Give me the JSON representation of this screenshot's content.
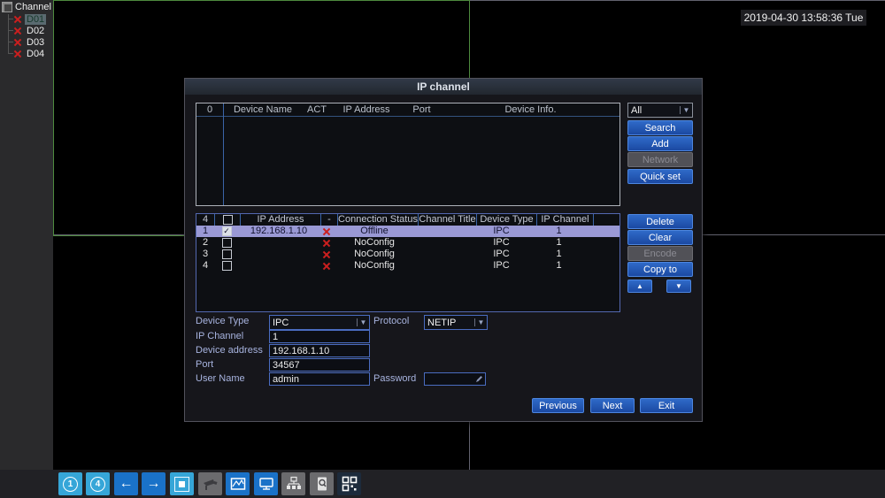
{
  "channel_panel": {
    "title": "Channel",
    "items": [
      {
        "label": "D01",
        "selected": true
      },
      {
        "label": "D02",
        "selected": false
      },
      {
        "label": "D03",
        "selected": false
      },
      {
        "label": "D04",
        "selected": false
      }
    ]
  },
  "clock": "2019-04-30 13:58:36 Tue",
  "dialog": {
    "title": "IP channel",
    "search_table": {
      "count": "0",
      "headers": [
        "Device Name",
        "ACT",
        "IP Address",
        "Port",
        "Device Info."
      ]
    },
    "filter": {
      "value": "All"
    },
    "actions": {
      "search": "Search",
      "add": "Add",
      "network": "Network",
      "quick_set": "Quick set"
    },
    "device_table": {
      "count": "4",
      "headers": [
        "IP Address",
        "-",
        "Connection Status",
        "Channel Title",
        "Device Type",
        "IP Channel"
      ],
      "rows": [
        {
          "index": "1",
          "checked": true,
          "ip": "192.168.1.10",
          "status": "Offline",
          "channel_title": "",
          "device_type": "IPC",
          "ip_channel": "1"
        },
        {
          "index": "2",
          "checked": false,
          "ip": "",
          "status": "NoConfig",
          "channel_title": "",
          "device_type": "IPC",
          "ip_channel": "1"
        },
        {
          "index": "3",
          "checked": false,
          "ip": "",
          "status": "NoConfig",
          "channel_title": "",
          "device_type": "IPC",
          "ip_channel": "1"
        },
        {
          "index": "4",
          "checked": false,
          "ip": "",
          "status": "NoConfig",
          "channel_title": "",
          "device_type": "IPC",
          "ip_channel": "1"
        }
      ]
    },
    "device_actions": {
      "delete": "Delete",
      "clear": "Clear",
      "encode": "Encode",
      "copy_to": "Copy to"
    },
    "form": {
      "device_type": {
        "label": "Device Type",
        "value": "IPC"
      },
      "protocol": {
        "label": "Protocol",
        "value": "NETIP"
      },
      "ip_channel": {
        "label": "IP Channel",
        "value": "1"
      },
      "device_address": {
        "label": "Device address",
        "value": "192.168.1.10"
      },
      "port": {
        "label": "Port",
        "value": "34567"
      },
      "user_name": {
        "label": "User Name",
        "value": "admin"
      },
      "password": {
        "label": "Password",
        "value": ""
      }
    },
    "footer": {
      "previous": "Previous",
      "next": "Next",
      "exit": "Exit"
    }
  },
  "icons": {
    "check": "✓",
    "dropdown": "▼",
    "up": "▲",
    "down": "▼"
  },
  "toolbar": {
    "buttons": [
      {
        "name": "single-view",
        "glyph": "1"
      },
      {
        "name": "quad-view",
        "glyph": "4"
      },
      {
        "name": "previous-channel",
        "glyph": "←"
      },
      {
        "name": "next-channel",
        "glyph": "→"
      },
      {
        "name": "stop-tour",
        "glyph": ""
      },
      {
        "name": "ptz-control",
        "glyph": ""
      },
      {
        "name": "color-setting",
        "glyph": ""
      },
      {
        "name": "output-adjust",
        "glyph": ""
      },
      {
        "name": "network-status",
        "glyph": ""
      },
      {
        "name": "storage-search",
        "glyph": ""
      },
      {
        "name": "system-info",
        "glyph": ""
      }
    ]
  },
  "colors": {
    "accent_blue": "#2461c0",
    "selection_lavender": "#9a99d5",
    "active_cell_green": "#4e8a3e",
    "status_red": "#cc1f1f",
    "toolbar_cyan": "#36a6d8"
  }
}
